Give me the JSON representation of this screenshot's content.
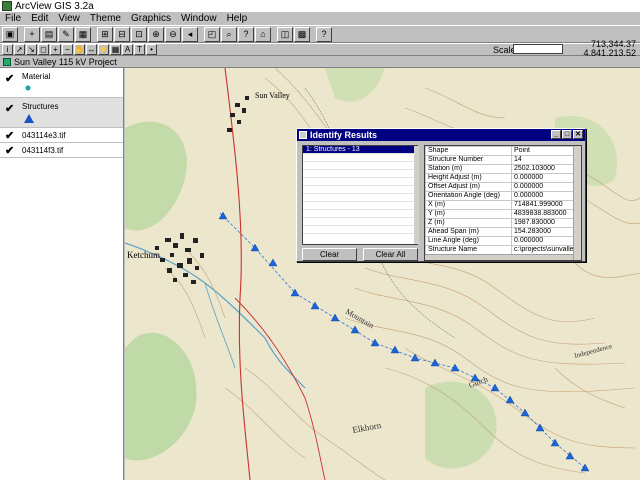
{
  "app": {
    "title": "ArcView GIS 3.2a"
  },
  "menu": [
    "File",
    "Edit",
    "View",
    "Theme",
    "Graphics",
    "Window",
    "Help"
  ],
  "toolbar1": {
    "icons": [
      "save-icon",
      "add-theme-icon",
      "theme-properties-icon",
      "edit-legend-icon",
      "table-icon",
      "zoom-full-icon",
      "zoom-active-icon",
      "zoom-selected-icon",
      "zoom-in-icon",
      "zoom-out-icon",
      "zoom-previous-icon",
      "select-features-icon",
      "find-icon",
      "query-builder-icon",
      "locate-address-icon",
      "clear-selected-icon",
      "select-all-icon",
      "help-icon"
    ]
  },
  "toolbar2": {
    "tools": [
      {
        "name": "identify-tool",
        "glyph": "i"
      },
      {
        "name": "pointer-tool",
        "glyph": "➚"
      },
      {
        "name": "vertex-edit-tool",
        "glyph": "↘"
      },
      {
        "name": "select-feature-tool",
        "glyph": "◻"
      },
      {
        "name": "zoom-in-tool",
        "glyph": "+"
      },
      {
        "name": "zoom-out-tool",
        "glyph": "−"
      },
      {
        "name": "pan-tool",
        "glyph": "✋"
      },
      {
        "name": "measure-tool",
        "glyph": "↔"
      },
      {
        "name": "hotlink-tool",
        "glyph": "⚡"
      },
      {
        "name": "area-of-interest-tool",
        "glyph": "▦"
      },
      {
        "name": "label-tool",
        "glyph": "A"
      },
      {
        "name": "text-tool",
        "glyph": "T"
      },
      {
        "name": "draw-point-tool",
        "glyph": "•"
      }
    ],
    "scale_label": "Scale 1:",
    "scale_value": "",
    "coord_x": "713,344.37",
    "coord_y": "4,841,213.52"
  },
  "view": {
    "title": "Sun Valley 115 kV Project"
  },
  "toc": [
    {
      "label": "Material",
      "symbol": "dot",
      "color": "#1aa0a0"
    },
    {
      "label": "Structures",
      "symbol": "triangle",
      "color": "#1a50c8"
    },
    {
      "label": "043114e3.tif",
      "symbol": "none"
    },
    {
      "label": "043114f3.tif",
      "symbol": "none"
    }
  ],
  "map": {
    "labels": [
      {
        "text": "Sun Valley",
        "key": "town1"
      },
      {
        "text": "Ketchum",
        "key": "town2"
      },
      {
        "text": "Elkhorn",
        "key": "place1"
      },
      {
        "text": "Independence",
        "key": "place2"
      },
      {
        "text": "Gulch",
        "key": "place3"
      },
      {
        "text": "Mountain",
        "key": "place4"
      }
    ],
    "structure_color": "#1a64dc"
  },
  "identify": {
    "title": "Identify Results",
    "selected_item": "1: Structures - 13",
    "clear_label": "Clear",
    "clear_all_label": "Clear All",
    "attributes": [
      {
        "key": "Shape",
        "value": "Point"
      },
      {
        "key": "Structure Number",
        "value": "14"
      },
      {
        "key": "Station  (m)",
        "value": "2502.103000"
      },
      {
        "key": "Height Adjust  (m)",
        "value": "0.000000"
      },
      {
        "key": "Offset Adjust  (m)",
        "value": "0.000000"
      },
      {
        "key": "Orientation Angle (deg)",
        "value": "0.000000"
      },
      {
        "key": "X  (m)",
        "value": "714841.999000"
      },
      {
        "key": "Y  (m)",
        "value": "4839838.883000"
      },
      {
        "key": "Z  (m)",
        "value": "1987.830000"
      },
      {
        "key": "Ahead Span (m)",
        "value": "154.283000"
      },
      {
        "key": "Line Angle (deg)",
        "value": "0.000000"
      },
      {
        "key": "Structure Name",
        "value": "c:\\projects\\sunvalle"
      }
    ]
  }
}
